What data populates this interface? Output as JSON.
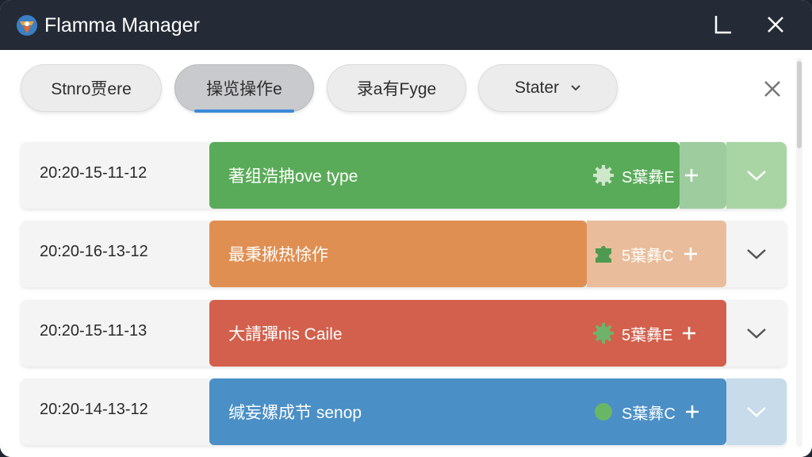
{
  "window": {
    "title": "Flamma Manager"
  },
  "filters": [
    {
      "label": "Stnro贾еre",
      "active": false
    },
    {
      "label": "操览操作e",
      "active": true
    },
    {
      "label": "录a有Fyge",
      "active": false
    },
    {
      "label": "Stater",
      "active": false,
      "dropdown": true
    }
  ],
  "rows": [
    {
      "date": "20:20-15-11-12",
      "label": "著组浩抩ove type",
      "badge": "S葉彝E",
      "color": "#5aab59",
      "expand_bg": "#a9d5a5",
      "badge_icon": "gear-icon",
      "badge_color": "#cfe8cc",
      "progress": 0.91
    },
    {
      "date": "20:20-16-13-12",
      "label": "最秉揪热悇作",
      "badge": "5葉彝C",
      "color": "#e08f52",
      "expand_bg": "#f4f4f4",
      "badge_icon": "puzzle-icon",
      "badge_color": "#4f9a52",
      "progress": 0.73
    },
    {
      "date": "20:20-15-11-13",
      "label": "大請彈nis Caile",
      "badge": "5葉彝E",
      "color": "#d3604c",
      "expand_bg": "#f4f4f4",
      "badge_icon": "gear-icon",
      "badge_color": "#6fb36a",
      "progress": 1.0
    },
    {
      "date": "20:20-14-13-12",
      "label": "缄妄嫘成节 senop",
      "badge": "S葉彝C",
      "color": "#4a8fc6",
      "expand_bg": "#c7dbea",
      "badge_icon": "circle-icon",
      "badge_color": "#69b766",
      "progress": 1.0
    }
  ]
}
